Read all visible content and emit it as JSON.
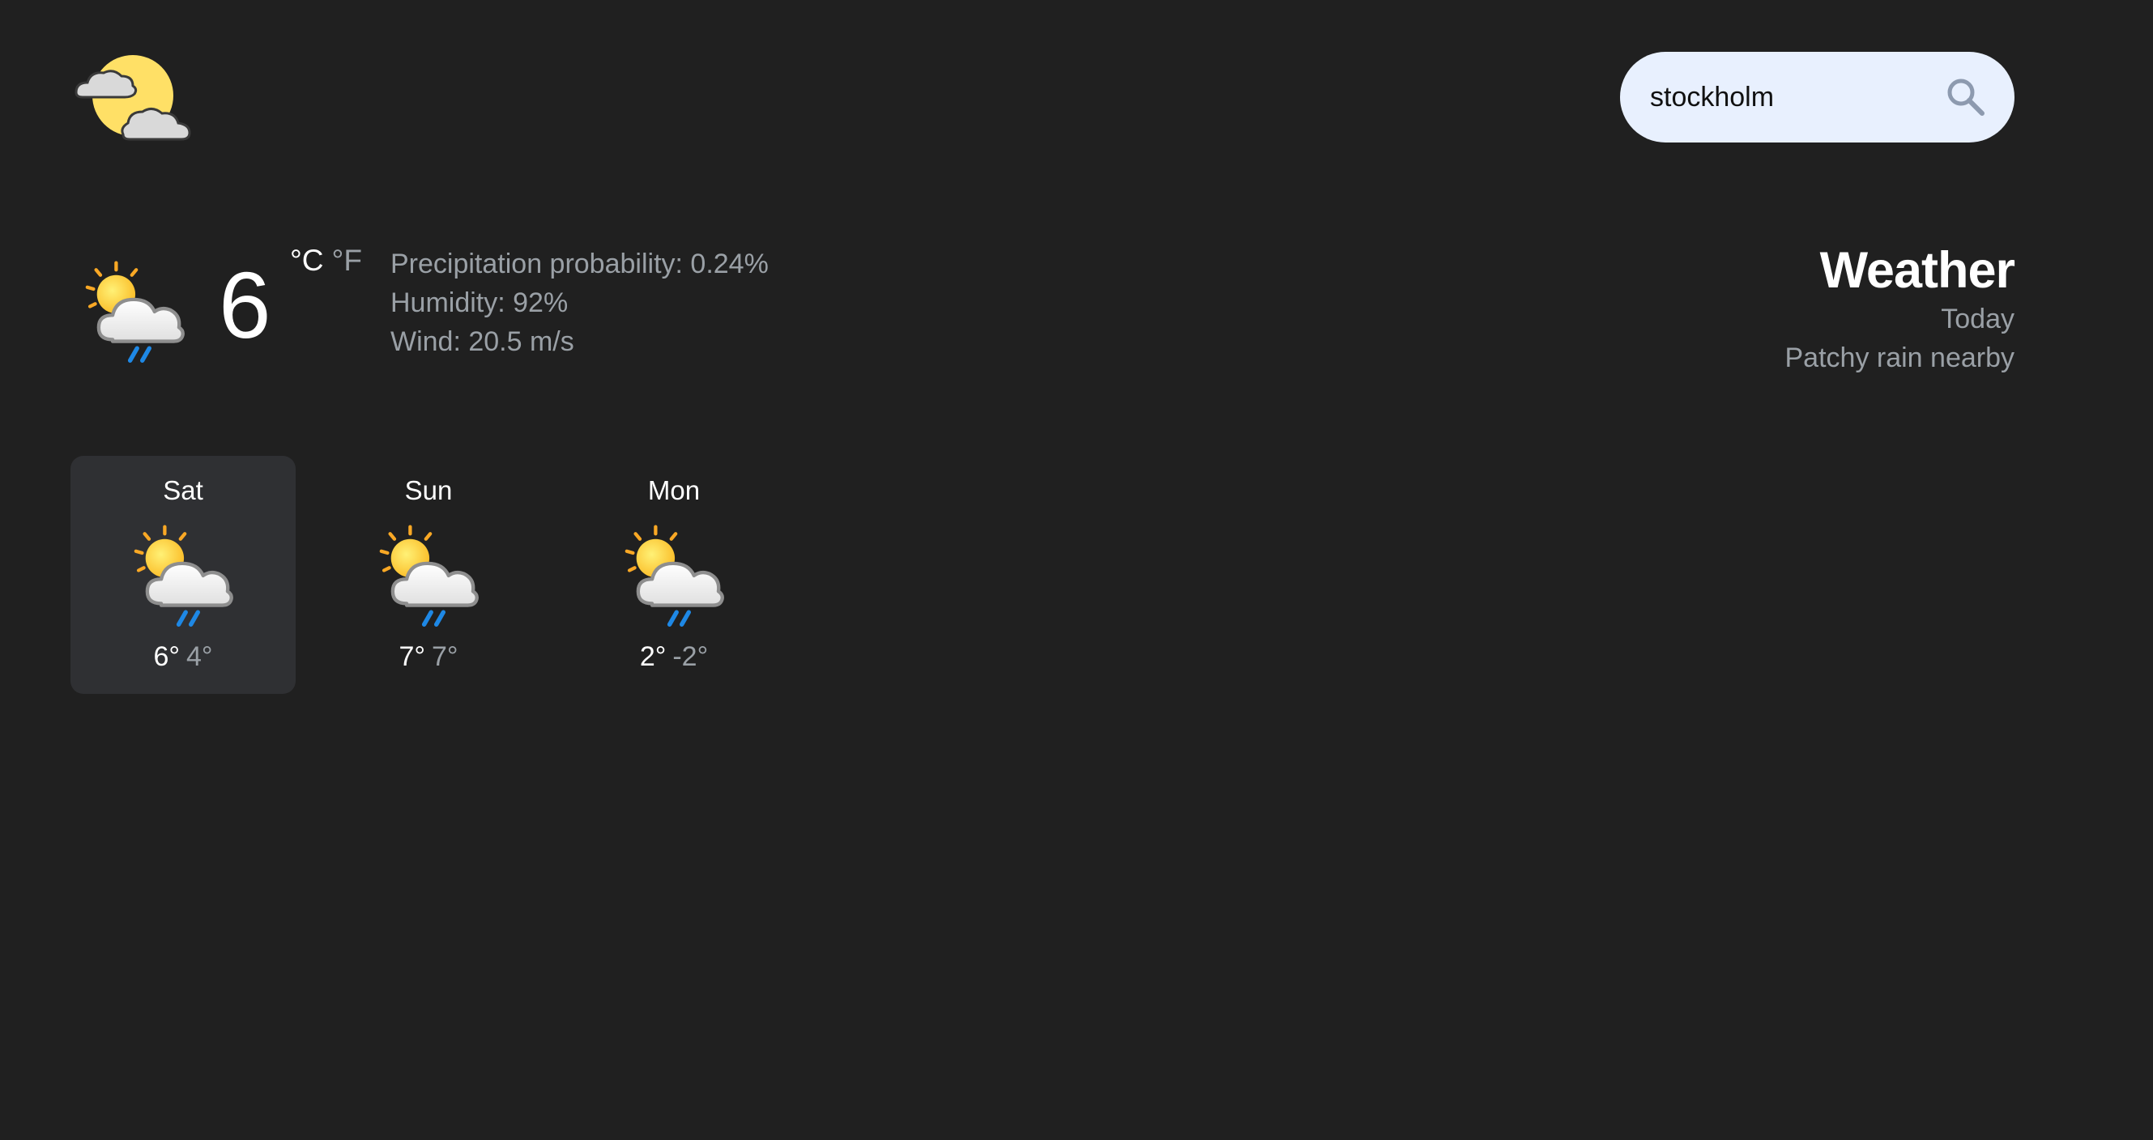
{
  "header": {
    "logo_icon": "partly-cloudy-logo-icon",
    "search": {
      "value": "stockholm",
      "icon": "search-icon"
    }
  },
  "current": {
    "icon": "patchy-rain-icon",
    "temperature": "6",
    "unit_c": "°C",
    "unit_f": "°F",
    "active_unit": "C",
    "precipitation": "Precipitation probability: 0.24%",
    "humidity": "Humidity: 92%",
    "wind": "Wind: 20.5 m/s"
  },
  "summary": {
    "title": "Weather",
    "day": "Today",
    "condition": "Patchy rain nearby"
  },
  "forecast": [
    {
      "day": "Sat",
      "high": "6°",
      "low": "4°",
      "icon": "patchy-rain-icon",
      "selected": true
    },
    {
      "day": "Sun",
      "high": "7°",
      "low": "7°",
      "icon": "patchy-rain-icon",
      "selected": false
    },
    {
      "day": "Mon",
      "high": "2°",
      "low": "-2°",
      "icon": "patchy-rain-icon",
      "selected": false
    }
  ],
  "colors": {
    "background": "#202020",
    "search_bg": "#e8f0fe",
    "selected_card": "#2f3033",
    "muted_text": "#9aa0a6",
    "sun": "#fbc02d",
    "rain": "#1e88e5"
  }
}
